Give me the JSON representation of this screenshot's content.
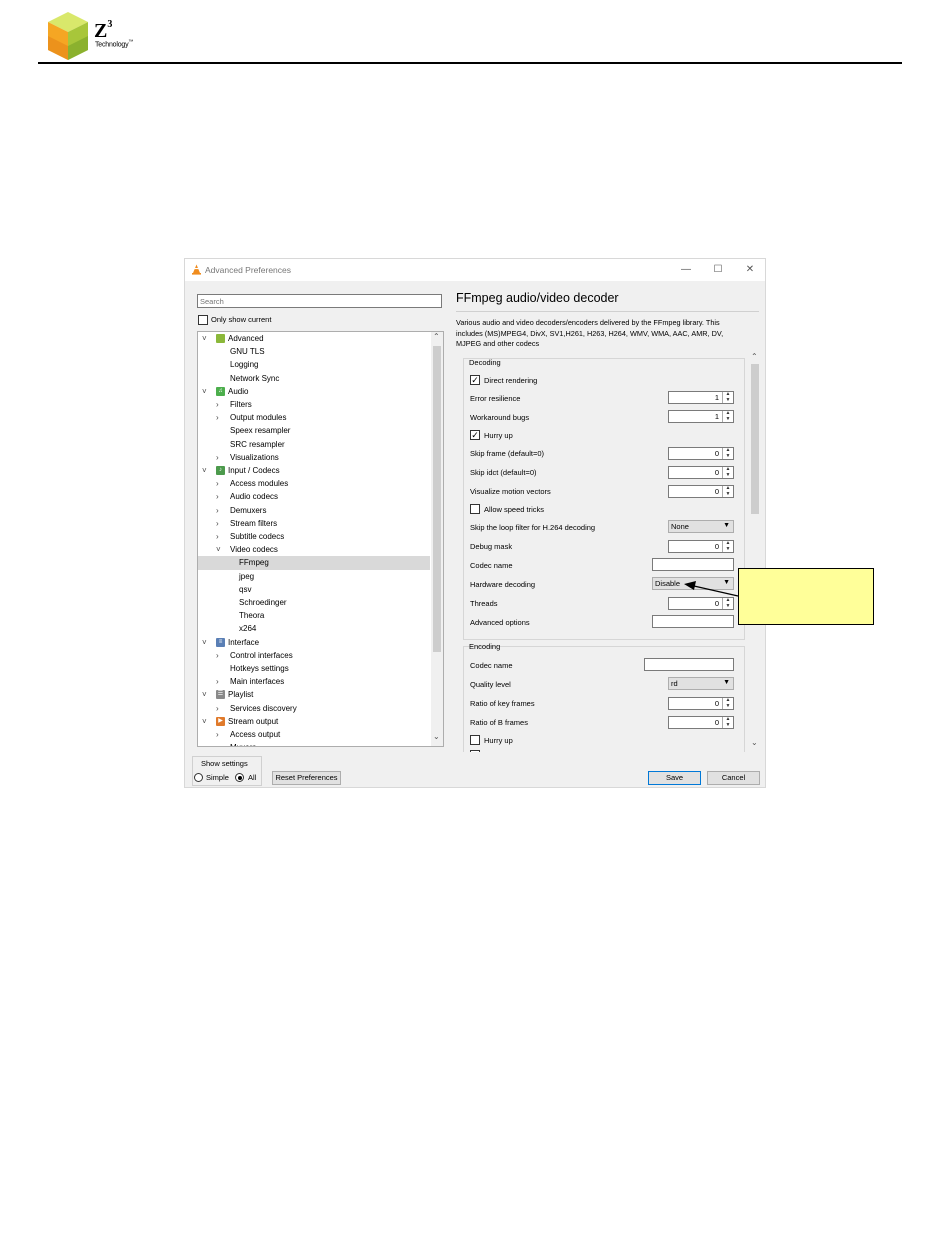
{
  "page_header": {
    "logo_letter": "Z",
    "logo_super": "3",
    "logo_tagline": "Technology",
    "logo_tm": "™"
  },
  "window": {
    "title": "Advanced Preferences",
    "minimize": "—",
    "maximize": "☐",
    "close": "✕"
  },
  "left": {
    "search_placeholder": "Search",
    "only_show_current": "Only show current",
    "tree": [
      {
        "label": "Advanced",
        "level": 0,
        "expand": "open",
        "icon": "chip-icon",
        "icon_color": "#8bb83a"
      },
      {
        "label": "GNU TLS",
        "level": 1,
        "expand": "none"
      },
      {
        "label": "Logging",
        "level": 1,
        "expand": "none"
      },
      {
        "label": "Network Sync",
        "level": 1,
        "expand": "none"
      },
      {
        "label": "Audio",
        "level": 0,
        "expand": "open",
        "icon": "music-note-icon",
        "icon_color": "#4cae4c"
      },
      {
        "label": "Filters",
        "level": 1,
        "expand": "closed"
      },
      {
        "label": "Output modules",
        "level": 1,
        "expand": "closed"
      },
      {
        "label": "Speex resampler",
        "level": 1,
        "expand": "none"
      },
      {
        "label": "SRC resampler",
        "level": 1,
        "expand": "none"
      },
      {
        "label": "Visualizations",
        "level": 1,
        "expand": "closed"
      },
      {
        "label": "Input / Codecs",
        "level": 0,
        "expand": "open",
        "icon": "codecs-icon",
        "icon_color": "#4c9a4c"
      },
      {
        "label": "Access modules",
        "level": 1,
        "expand": "closed"
      },
      {
        "label": "Audio codecs",
        "level": 1,
        "expand": "closed"
      },
      {
        "label": "Demuxers",
        "level": 1,
        "expand": "closed"
      },
      {
        "label": "Stream filters",
        "level": 1,
        "expand": "closed"
      },
      {
        "label": "Subtitle codecs",
        "level": 1,
        "expand": "closed"
      },
      {
        "label": "Video codecs",
        "level": 1,
        "expand": "open"
      },
      {
        "label": "FFmpeg",
        "level": 2,
        "expand": "none",
        "selected": true
      },
      {
        "label": "jpeg",
        "level": 2,
        "expand": "none"
      },
      {
        "label": "qsv",
        "level": 2,
        "expand": "none"
      },
      {
        "label": "Schroedinger",
        "level": 2,
        "expand": "none"
      },
      {
        "label": "Theora",
        "level": 2,
        "expand": "none"
      },
      {
        "label": "x264",
        "level": 2,
        "expand": "none"
      },
      {
        "label": "Interface",
        "level": 0,
        "expand": "open",
        "icon": "interface-icon",
        "icon_color": "#5a7fb5"
      },
      {
        "label": "Control interfaces",
        "level": 1,
        "expand": "closed"
      },
      {
        "label": "Hotkeys settings",
        "level": 1,
        "expand": "none"
      },
      {
        "label": "Main interfaces",
        "level": 1,
        "expand": "closed"
      },
      {
        "label": "Playlist",
        "level": 0,
        "expand": "open",
        "icon": "playlist-icon",
        "icon_color": "#8a8a8a"
      },
      {
        "label": "Services discovery",
        "level": 1,
        "expand": "closed"
      },
      {
        "label": "Stream output",
        "level": 0,
        "expand": "open",
        "icon": "stream-output-icon",
        "icon_color": "#e07a2b"
      },
      {
        "label": "Access output",
        "level": 1,
        "expand": "closed"
      },
      {
        "label": "Muxers",
        "level": 1,
        "expand": "closed"
      }
    ],
    "show_settings": {
      "title": "Show settings",
      "simple": "Simple",
      "all": "All",
      "selected": "All"
    },
    "reset_button": "Reset Preferences"
  },
  "right": {
    "title": "FFmpeg audio/video decoder",
    "description": "Various audio and video decoders/encoders delivered by the FFmpeg library. This includes (MS)MPEG4, DivX, SV1,H261, H263, H264, WMV, WMA, AAC, AMR, DV, MJPEG and other codecs",
    "decoding": {
      "title": "Decoding",
      "direct_rendering": "Direct rendering",
      "direct_rendering_checked": true,
      "error_resilience": "Error resilience",
      "error_resilience_value": "1",
      "workaround_bugs": "Workaround bugs",
      "workaround_bugs_value": "1",
      "hurry_up": "Hurry up",
      "hurry_up_checked": true,
      "skip_frame": "Skip frame (default=0)",
      "skip_frame_value": "0",
      "skip_idct": "Skip idct (default=0)",
      "skip_idct_value": "0",
      "visualize_motion": "Visualize motion vectors",
      "visualize_motion_value": "0",
      "allow_speed_tricks": "Allow speed tricks",
      "allow_speed_tricks_checked": false,
      "skip_loop_filter": "Skip the loop filter for H.264 decoding",
      "skip_loop_filter_value": "None",
      "debug_mask": "Debug mask",
      "debug_mask_value": "0",
      "codec_name": "Codec name",
      "codec_name_value": "",
      "hardware_decoding": "Hardware decoding",
      "hardware_decoding_value": "Disable",
      "threads": "Threads",
      "threads_value": "0",
      "advanced_options": "Advanced options",
      "advanced_options_value": ""
    },
    "encoding": {
      "title": "Encoding",
      "codec_name": "Codec name",
      "codec_name_value": "",
      "quality_level": "Quality level",
      "quality_level_value": "rd",
      "ratio_key_frames": "Ratio of key frames",
      "ratio_key_frames_value": "0",
      "ratio_b_frames": "Ratio of B frames",
      "ratio_b_frames_value": "0",
      "hurry_up": "Hurry up",
      "hurry_up_checked": false
    },
    "save_button": "Save",
    "cancel_button": "Cancel"
  },
  "colors": {
    "callout_fill": "#ffff99",
    "vlc_cone": "#f08c1e"
  }
}
